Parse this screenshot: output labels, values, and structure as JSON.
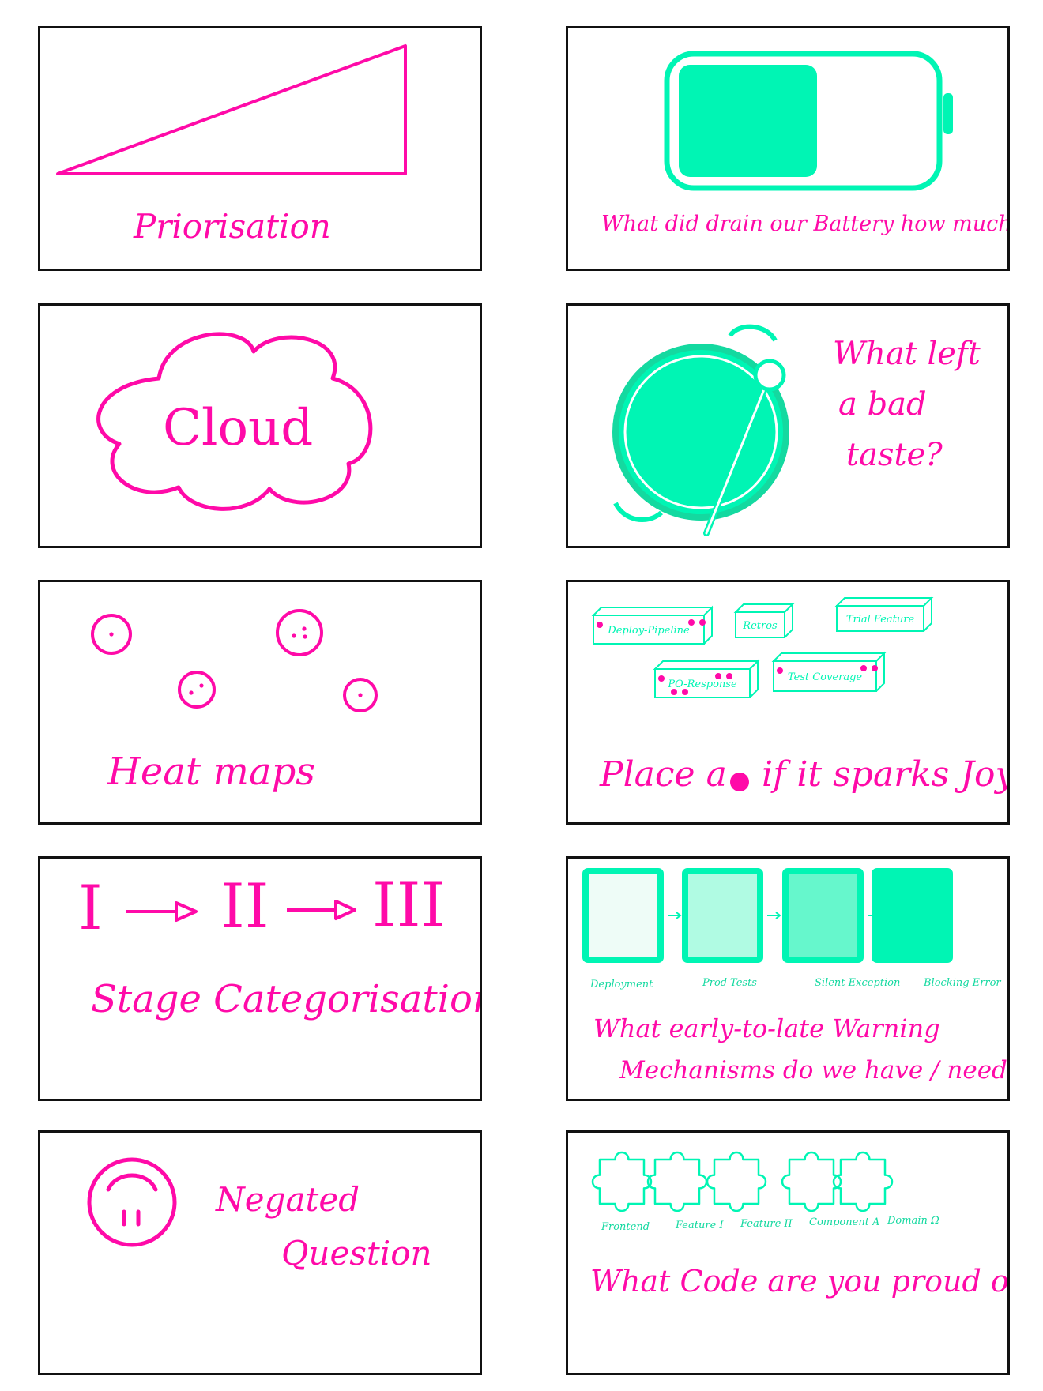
{
  "colors": {
    "pink": "#ff0aa8",
    "mint": "#00f5b4",
    "border": "#111111"
  },
  "cards": {
    "prioritisation": {
      "label": "Priorisation",
      "icon": "triangle-ramp-icon"
    },
    "battery": {
      "question": "What did drain our Battery how much?",
      "icon": "battery-icon",
      "charge_level": 0.55
    },
    "cloud": {
      "label": "Cloud",
      "icon": "cloud-icon"
    },
    "bad_taste": {
      "line1": "What left",
      "line2": "a bad",
      "line3": "taste?",
      "icon": "pot-icon"
    },
    "heat_maps": {
      "label": "Heat maps",
      "icon": "dot-circle-icon",
      "dot_counts": [
        1,
        3,
        2,
        1
      ]
    },
    "sparks_joy": {
      "question_part1": "Place a",
      "question_part2": "if it sparks Joy",
      "boxes": [
        {
          "label": "Deploy-Pipeline",
          "dots": 3
        },
        {
          "label": "Retros",
          "dots": 0
        },
        {
          "label": "Trial Feature",
          "dots": 0
        },
        {
          "label": "PO-Response",
          "dots": 5
        },
        {
          "label": "Test Coverage",
          "dots": 3
        }
      ]
    },
    "stage_categorisation": {
      "label": "Stage Categorisation",
      "stages": [
        "I",
        "II",
        "III"
      ]
    },
    "warning": {
      "line1": "What early-to-late Warning",
      "line2": "Mechanisms do we have / need?",
      "stages": [
        {
          "label": "Deployment",
          "fill": "#eefcf7"
        },
        {
          "label": "Prod-Tests",
          "fill": "#b0fbe3"
        },
        {
          "label": "Silent Exception",
          "fill": "#66f7cc"
        },
        {
          "label": "Blocking Error",
          "fill": "#00f5b4"
        }
      ]
    },
    "negated": {
      "line1": "Negated",
      "line2": "Question",
      "icon": "frown-face-icon"
    },
    "code_pride": {
      "question": "What Code are you proud of ?",
      "pieces": [
        "Frontend",
        "Feature I",
        "Feature II",
        "Component A",
        "Domain Ω"
      ]
    }
  }
}
